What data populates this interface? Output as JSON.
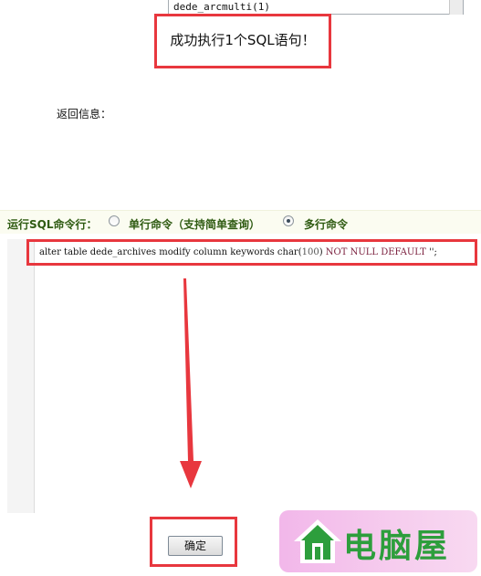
{
  "table_list": {
    "visible_item": "dede_arcmulti(1)"
  },
  "result": {
    "message": "成功执行1个SQL语句！"
  },
  "return_info": {
    "label": "返回信息："
  },
  "command_mode": {
    "label": "运行SQL命令行：",
    "options": [
      {
        "label": "单行命令（支持简单查询）",
        "selected": false
      },
      {
        "label": "多行命令",
        "selected": true
      }
    ]
  },
  "sql_editor": {
    "line_parts": {
      "p1": "alter table dede_archives modify column keywords char(",
      "num": "100",
      "p2": ") ",
      "kw": "NOT NULL DEFAULT",
      "p3": " '';"
    }
  },
  "confirm": {
    "label": "确定"
  },
  "watermark": {
    "text": "电脑屋"
  },
  "colors": {
    "highlight_border": "#e8373e",
    "label_green": "#2f5b12",
    "logo_green": "#2d9e3c",
    "logo_pink": "#f2b7ea"
  }
}
